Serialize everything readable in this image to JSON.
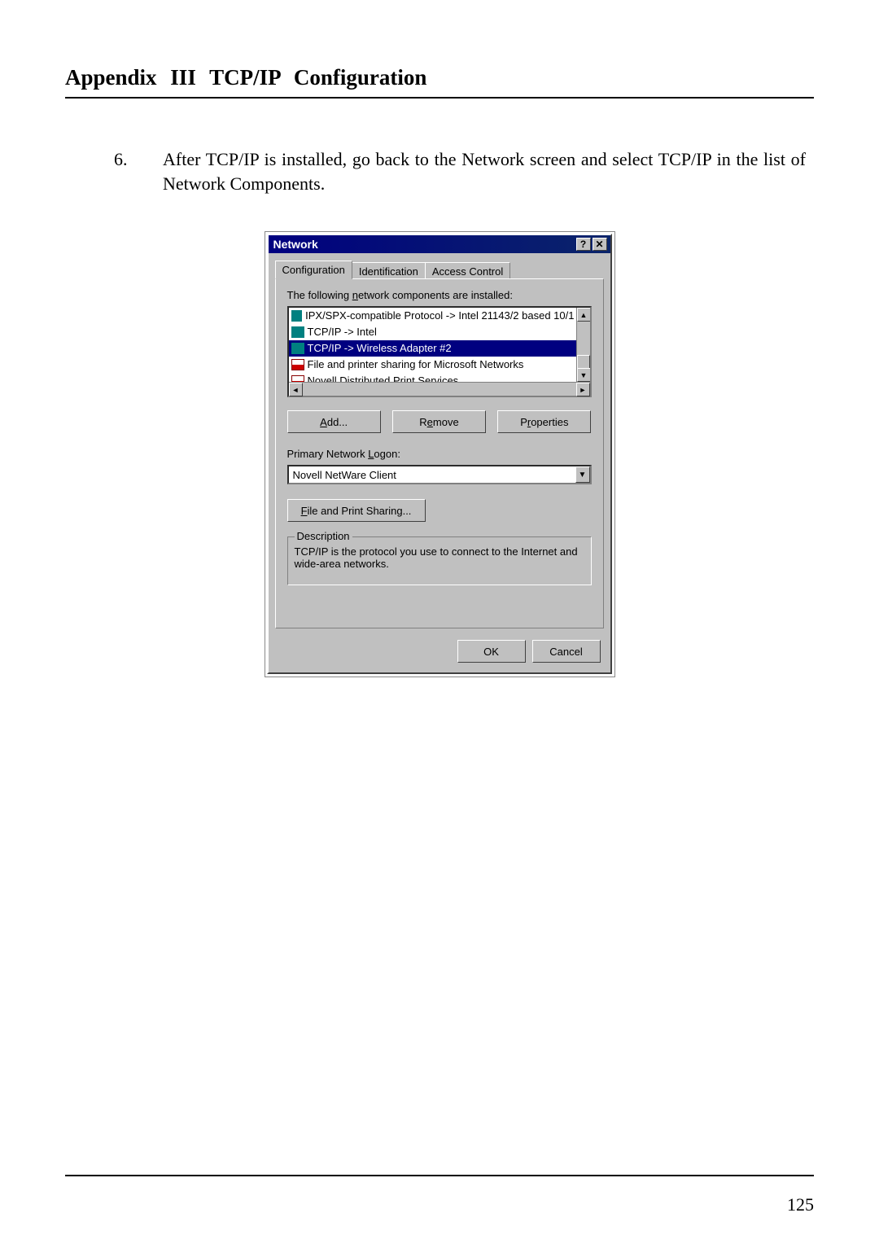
{
  "appendix_title": "Appendix III  TCP/IP Configuration",
  "step_number": "6.",
  "step_text": "After TCP/IP is installed, go back to the Network screen and select TCP/IP in the list of Network Components.",
  "page_number": "125",
  "dialog": {
    "title": "Network",
    "help_btn": "?",
    "close_btn": "✕",
    "tabs": {
      "configuration": "Configuration",
      "identification": "Identification",
      "access_control": "Access Control"
    },
    "list_label_pre": "The following ",
    "list_label_mn": "n",
    "list_label_post": "etwork components are installed:",
    "items": [
      {
        "text": "IPX/SPX-compatible Protocol -> Intel 21143/2 based 10/1",
        "icon": "proto",
        "selected": false
      },
      {
        "text": "TCP/IP -> Intel",
        "icon": "proto",
        "selected": false
      },
      {
        "text": "TCP/IP -> Wireless Adapter #2",
        "icon": "proto",
        "selected": true
      },
      {
        "text": "File and printer sharing for Microsoft Networks",
        "icon": "svc",
        "selected": false
      },
      {
        "text": "Novell Distributed Print Services",
        "icon": "svc",
        "selected": false
      }
    ],
    "scroll_up": "▲",
    "scroll_down": "▼",
    "scroll_left": "◄",
    "scroll_right": "►",
    "btn_add_mn": "A",
    "btn_add_rest": "dd...",
    "btn_remove_pre": "R",
    "btn_remove_mn": "e",
    "btn_remove_post": "move",
    "btn_properties_pre": "P",
    "btn_properties_mn": "r",
    "btn_properties_post": "operties",
    "logon_label_pre": "Primary Network ",
    "logon_label_mn": "L",
    "logon_label_post": "ogon:",
    "logon_value": "Novell NetWare Client",
    "combo_arrow": "▼",
    "fps_mn": "F",
    "fps_rest": "ile and Print Sharing...",
    "desc_legend": "Description",
    "desc_text": "TCP/IP is the protocol you use to connect to the Internet and wide-area networks.",
    "ok": "OK",
    "cancel": "Cancel"
  }
}
